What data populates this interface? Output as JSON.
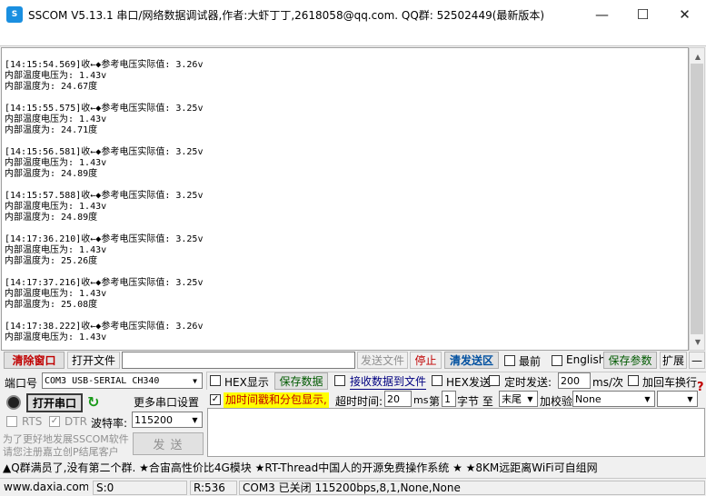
{
  "window": {
    "title": "SSCOM V5.13.1 串口/网络数据调试器,作者:大虾丁丁,2618058@qq.com. QQ群:  52502449(最新版本)",
    "icon_text": "S",
    "minimize": "—",
    "maximize": "☐",
    "close": "✕"
  },
  "log": [
    {
      "header": "[14:15:54.569]收←◆参考电压实际值: 3.26v",
      "l1": "内部温度电压为: 1.43v",
      "l2": "内部温度为: 24.67度"
    },
    {
      "header": "[14:15:55.575]收←◆参考电压实际值: 3.25v",
      "l1": "内部温度电压为: 1.43v",
      "l2": "内部温度为: 24.71度"
    },
    {
      "header": "[14:15:56.581]收←◆参考电压实际值: 3.25v",
      "l1": "内部温度电压为: 1.43v",
      "l2": "内部温度为: 24.89度"
    },
    {
      "header": "[14:15:57.588]收←◆参考电压实际值: 3.25v",
      "l1": "内部温度电压为: 1.43v",
      "l2": "内部温度为: 24.89度"
    },
    {
      "header": "[14:17:36.210]收←◆参考电压实际值: 3.25v",
      "l1": "内部温度电压为: 1.43v",
      "l2": "内部温度为: 25.26度"
    },
    {
      "header": "[14:17:37.216]收←◆参考电压实际值: 3.25v",
      "l1": "内部温度电压为: 1.43v",
      "l2": "内部温度为: 25.08度"
    },
    {
      "header": "[14:17:38.222]收←◆参考电压实际值: 3.26v",
      "l1": "内部温度电压为: 1.43v",
      "l2": ""
    }
  ],
  "toolbar": {
    "clear_window": "清除窗口",
    "open_file": "打开文件",
    "send_file": "发送文件",
    "stop": "停止",
    "clear_send_area": "清发送区",
    "topmost": "最前",
    "english": "English",
    "save_params": "保存参数",
    "expand": "扩展",
    "collapse": "—"
  },
  "port": {
    "port_label": "端口号",
    "port_value": "COM3 USB-SERIAL CH340",
    "open_port": "打开串口",
    "more_settings": "更多串口设置",
    "rts": "RTS",
    "dtr": "DTR",
    "baud_label": "波特率:",
    "baud_value": "115200"
  },
  "options": {
    "hex_display": "HEX显示",
    "save_data": "保存数据",
    "recv_to_file": "接收数据到文件",
    "hex_send": "HEX发送",
    "timed_send": "定时发送:",
    "timed_value": "200",
    "timed_unit": "ms/次",
    "add_crlf": "加回车换行",
    "timestamp": "加时间戳和分包显示,",
    "timeout_label": "超时时间:",
    "timeout_value": "20",
    "timeout_unit": "ms",
    "byte_from_label": "第",
    "byte_from_value": "1",
    "byte_to_label": "字节 至",
    "byte_to_value": "末尾",
    "checksum_label": "加校验",
    "checksum_value": "None",
    "help": "?"
  },
  "promo": {
    "line1": "为了更好地发展SSCOM软件",
    "line2": "请您注册嘉立创P结尾客户",
    "send": "发 送"
  },
  "marquee": "▲Q群满员了,没有第二个群. ★合宙高性价比4G模块 ★RT-Thread中国人的开源免费操作系统 ★ ★8KM远距离WiFi可自组网",
  "statusbar": {
    "website": "www.daxia.com",
    "sent": "S:0",
    "received": "R:536",
    "port_status": "COM3 已关闭  115200bps,8,1,None,None"
  }
}
